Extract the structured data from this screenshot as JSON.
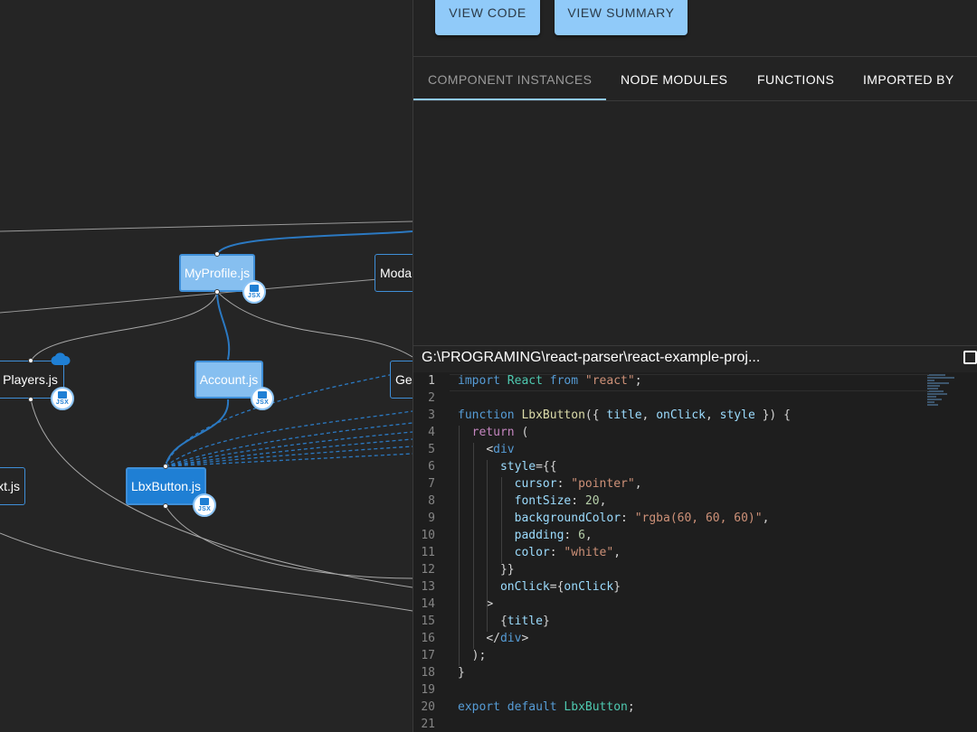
{
  "graph": {
    "nodes": {
      "myprofile": "MyProfile.js",
      "modal": "Moda",
      "players": "Players.js",
      "account": "Account.js",
      "ge": "Ge",
      "text": "xt.js",
      "lbxbutton": "LbxButton.js"
    },
    "jsx_badge": "JSX"
  },
  "panel": {
    "buttons": {
      "view_code": "VIEW CODE",
      "view_summary": "VIEW SUMMARY"
    },
    "tabs": [
      "COMPONENT INSTANCES",
      "NODE MODULES",
      "FUNCTIONS",
      "IMPORTED BY"
    ],
    "active_tab": "COMPONENT INSTANCES"
  },
  "editor": {
    "file_path": "G:\\PROGRAMING\\react-parser\\react-example-proj...",
    "current_line": 1,
    "lines": [
      [
        [
          "tk-kw",
          "import"
        ],
        [
          "tk-def",
          " "
        ],
        [
          "tk-cls",
          "React"
        ],
        [
          "tk-def",
          " "
        ],
        [
          "tk-kw",
          "from"
        ],
        [
          "tk-def",
          " "
        ],
        [
          "tk-str",
          "\"react\""
        ],
        [
          "tk-pun",
          ";"
        ]
      ],
      [],
      [
        [
          "tk-kw",
          "function"
        ],
        [
          "tk-def",
          " "
        ],
        [
          "tk-fn",
          "LbxButton"
        ],
        [
          "tk-pun",
          "({ "
        ],
        [
          "tk-var",
          "title"
        ],
        [
          "tk-pun",
          ", "
        ],
        [
          "tk-var",
          "onClick"
        ],
        [
          "tk-pun",
          ", "
        ],
        [
          "tk-var",
          "style"
        ],
        [
          "tk-pun",
          " }) {"
        ]
      ],
      [
        [
          "tk-def",
          "  "
        ],
        [
          "tk-ctl",
          "return"
        ],
        [
          "tk-pun",
          " ("
        ]
      ],
      [
        [
          "tk-def",
          "    "
        ],
        [
          "tk-pun",
          "<"
        ],
        [
          "tk-tag",
          "div"
        ]
      ],
      [
        [
          "tk-def",
          "      "
        ],
        [
          "tk-var",
          "style"
        ],
        [
          "tk-pun",
          "={{"
        ]
      ],
      [
        [
          "tk-def",
          "        "
        ],
        [
          "tk-var",
          "cursor"
        ],
        [
          "tk-pun",
          ": "
        ],
        [
          "tk-str",
          "\"pointer\""
        ],
        [
          "tk-pun",
          ","
        ]
      ],
      [
        [
          "tk-def",
          "        "
        ],
        [
          "tk-var",
          "fontSize"
        ],
        [
          "tk-pun",
          ": "
        ],
        [
          "tk-num",
          "20"
        ],
        [
          "tk-pun",
          ","
        ]
      ],
      [
        [
          "tk-def",
          "        "
        ],
        [
          "tk-var",
          "backgroundColor"
        ],
        [
          "tk-pun",
          ": "
        ],
        [
          "tk-str",
          "\"rgba(60, 60, 60)\""
        ],
        [
          "tk-pun",
          ","
        ]
      ],
      [
        [
          "tk-def",
          "        "
        ],
        [
          "tk-var",
          "padding"
        ],
        [
          "tk-pun",
          ": "
        ],
        [
          "tk-num",
          "6"
        ],
        [
          "tk-pun",
          ","
        ]
      ],
      [
        [
          "tk-def",
          "        "
        ],
        [
          "tk-var",
          "color"
        ],
        [
          "tk-pun",
          ": "
        ],
        [
          "tk-str",
          "\"white\""
        ],
        [
          "tk-pun",
          ","
        ]
      ],
      [
        [
          "tk-def",
          "      "
        ],
        [
          "tk-pun",
          "}}"
        ]
      ],
      [
        [
          "tk-def",
          "      "
        ],
        [
          "tk-var",
          "onClick"
        ],
        [
          "tk-pun",
          "={"
        ],
        [
          "tk-var",
          "onClick"
        ],
        [
          "tk-pun",
          "}"
        ]
      ],
      [
        [
          "tk-def",
          "    "
        ],
        [
          "tk-pun",
          ">"
        ]
      ],
      [
        [
          "tk-def",
          "      "
        ],
        [
          "tk-pun",
          "{"
        ],
        [
          "tk-var",
          "title"
        ],
        [
          "tk-pun",
          "}"
        ]
      ],
      [
        [
          "tk-def",
          "    "
        ],
        [
          "tk-pun",
          "</"
        ],
        [
          "tk-tag",
          "div"
        ],
        [
          "tk-pun",
          ">"
        ]
      ],
      [
        [
          "tk-def",
          "  "
        ],
        [
          "tk-pun",
          ");"
        ]
      ],
      [
        [
          "tk-pun",
          "}"
        ]
      ],
      [],
      [
        [
          "tk-kw",
          "export"
        ],
        [
          "tk-def",
          " "
        ],
        [
          "tk-kw",
          "default"
        ],
        [
          "tk-def",
          " "
        ],
        [
          "tk-cls",
          "LbxButton"
        ],
        [
          "tk-pun",
          ";"
        ]
      ],
      []
    ]
  },
  "colors": {
    "accent": "#90caf9",
    "node_blue": "#1f7fd4",
    "node_light": "#86bff0",
    "background": "#252525",
    "editor_bg": "#1e1e1e"
  }
}
